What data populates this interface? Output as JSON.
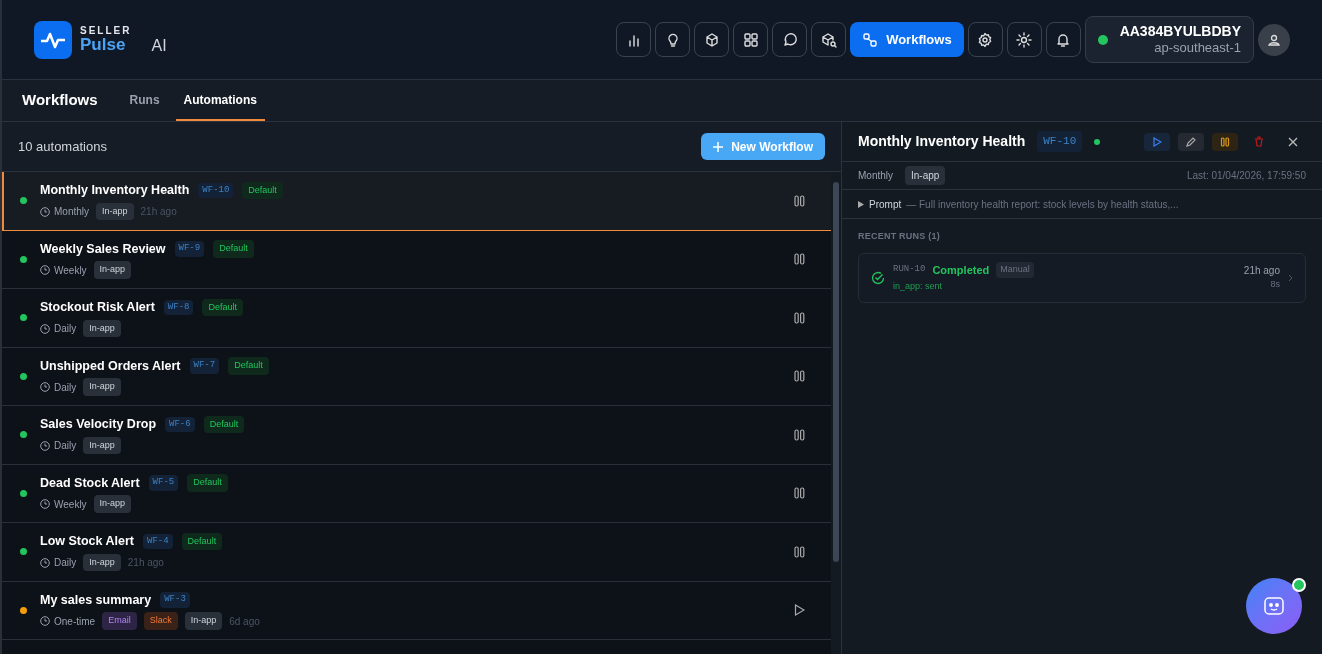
{
  "brand": {
    "top": "SELLER",
    "name": "Pulse",
    "suffix": "AI"
  },
  "toolbar": {
    "workflows_button": {
      "label": "Workflows",
      "selected": true
    }
  },
  "account": {
    "id": "AA384BYULBDBY",
    "region": "ap-southeast-1",
    "online": true
  },
  "page_title": "Workflows",
  "tabs": [
    {
      "label": "Runs",
      "selected": false
    },
    {
      "label": "Automations",
      "selected": true
    }
  ],
  "list": {
    "count": "10 automations",
    "new_button": "New Workflow",
    "rows": [
      {
        "name": "Monthly Inventory Health",
        "id": "WF-10",
        "default": "Default",
        "schedule": "Monthly",
        "channels": [
          {
            "kind": "inapp",
            "label": "In-app"
          }
        ],
        "ago": "21h ago",
        "color": "#22c55e",
        "active": true,
        "selected": true
      },
      {
        "name": "Weekly Sales Review",
        "id": "WF-9",
        "default": "Default",
        "schedule": "Weekly",
        "channels": [
          {
            "kind": "inapp",
            "label": "In-app"
          }
        ],
        "color": "#22c55e",
        "active": true,
        "selected": false
      },
      {
        "name": "Stockout Risk Alert",
        "id": "WF-8",
        "default": "Default",
        "schedule": "Daily",
        "channels": [
          {
            "kind": "inapp",
            "label": "In-app"
          }
        ],
        "color": "#22c55e",
        "active": true,
        "selected": false
      },
      {
        "name": "Unshipped Orders Alert",
        "id": "WF-7",
        "default": "Default",
        "schedule": "Daily",
        "channels": [
          {
            "kind": "inapp",
            "label": "In-app"
          }
        ],
        "color": "#22c55e",
        "active": true,
        "selected": false
      },
      {
        "name": "Sales Velocity Drop",
        "id": "WF-6",
        "default": "Default",
        "schedule": "Daily",
        "channels": [
          {
            "kind": "inapp",
            "label": "In-app"
          }
        ],
        "color": "#22c55e",
        "active": true,
        "selected": false
      },
      {
        "name": "Dead Stock Alert",
        "id": "WF-5",
        "default": "Default",
        "schedule": "Weekly",
        "channels": [
          {
            "kind": "inapp",
            "label": "In-app"
          }
        ],
        "color": "#22c55e",
        "active": true,
        "selected": false
      },
      {
        "name": "Low Stock Alert",
        "id": "WF-4",
        "default": "Default",
        "schedule": "Daily",
        "channels": [
          {
            "kind": "inapp",
            "label": "In-app"
          }
        ],
        "ago": "21h ago",
        "color": "#22c55e",
        "active": true,
        "selected": false
      },
      {
        "name": "My sales summary",
        "id": "WF-3",
        "schedule": "One-time",
        "channels": [
          {
            "kind": "email",
            "label": "Email"
          },
          {
            "kind": "slack",
            "label": "Slack"
          },
          {
            "kind": "inapp",
            "label": "In-app"
          }
        ],
        "ago": "6d ago",
        "color": "#f59e0b",
        "active": false,
        "selected": false
      }
    ]
  },
  "detail": {
    "title": "Monthly Inventory Health",
    "id": "WF-10",
    "active": true,
    "schedule": "Monthly",
    "channel": "In-app",
    "last": "Last: 01/04/2026, 17:59:50",
    "prompt_label": "Prompt",
    "prompt_text": "— Full inventory health report: stock levels by health status,...",
    "runs_heading": "RECENT RUNS (1)",
    "runs": [
      {
        "id": "RUN-10",
        "status": "Completed",
        "trigger": "Manual",
        "result": "in_app: sent",
        "ago": "21h ago",
        "duration": "8s"
      }
    ]
  }
}
